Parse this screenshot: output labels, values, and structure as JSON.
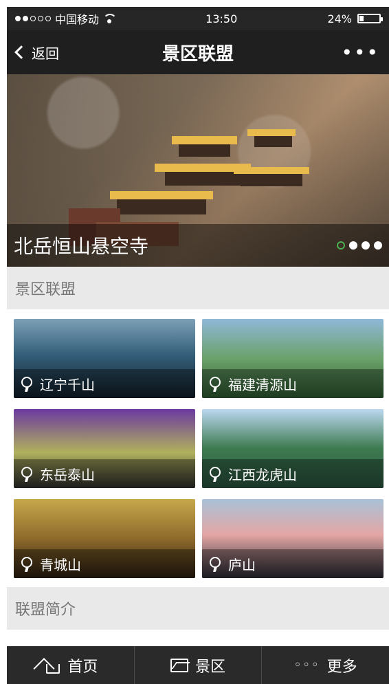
{
  "status_bar": {
    "carrier": "中国移动",
    "time": "13:50",
    "battery": "24%"
  },
  "nav": {
    "back_label": "返回",
    "title": "景区联盟",
    "more_label": "•••"
  },
  "hero": {
    "title": "北岳恒山悬空寺",
    "pager": {
      "count": 4,
      "active_index": 0
    }
  },
  "sections": {
    "alliance": "景区联盟",
    "intro": "联盟简介"
  },
  "scenic_spots": [
    {
      "name": "辽宁千山"
    },
    {
      "name": "福建清源山"
    },
    {
      "name": "东岳泰山"
    },
    {
      "name": "江西龙虎山"
    },
    {
      "name": "青城山"
    },
    {
      "name": "庐山"
    }
  ],
  "tabs": [
    {
      "label": "首页",
      "icon": "home-icon"
    },
    {
      "label": "景区",
      "icon": "image-icon"
    },
    {
      "label": "更多",
      "icon": "more-icon"
    }
  ]
}
